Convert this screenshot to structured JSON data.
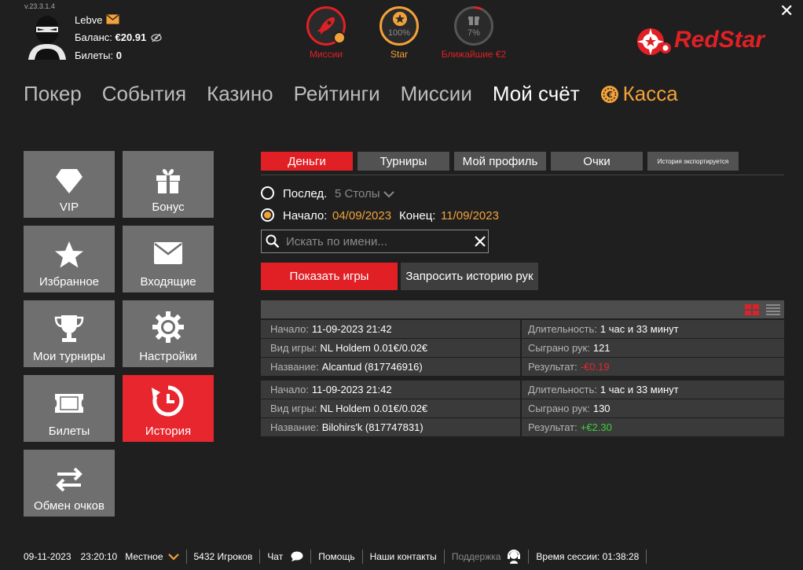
{
  "version": "v.23.3.1.4",
  "user": {
    "name": "Lebve",
    "balance_label": "Баланс:",
    "balance_value": "€20.91",
    "tickets_label": "Билеты:",
    "tickets_value": "0"
  },
  "top_widgets": [
    {
      "label": "Миссии",
      "icon": "rocket-icon",
      "color": "#e12026"
    },
    {
      "label": "Star",
      "value": "100%",
      "icon": "star-icon",
      "color": "#f3a23a"
    },
    {
      "label": "Ближайшие €2",
      "value": "7%",
      "icon": "gift-icon",
      "color": "#e12026"
    }
  ],
  "brand": {
    "logo_text": "RedStar",
    "color": "#e12026"
  },
  "nav": [
    "Покер",
    "События",
    "Казино",
    "Рейтинги",
    "Миссии",
    "Мой счёт",
    "Касса"
  ],
  "tiles": [
    {
      "label": "VIP",
      "icon": "diamond-icon"
    },
    {
      "label": "Бонус",
      "icon": "gift-icon"
    },
    {
      "label": "Избранное",
      "icon": "star-icon"
    },
    {
      "label": "Входящие",
      "icon": "envelope-icon"
    },
    {
      "label": "Мои турниры",
      "icon": "trophy-icon"
    },
    {
      "label": "Настройки",
      "icon": "gear-icon"
    },
    {
      "label": "Билеты",
      "icon": "ticket-icon"
    },
    {
      "label": "История",
      "icon": "history-icon",
      "active": true
    },
    {
      "label": "Обмен очков",
      "icon": "exchange-icon"
    }
  ],
  "tabs": [
    "Деньги",
    "Турниры",
    "Мой профиль",
    "Очки",
    "История экспортируется"
  ],
  "filters": {
    "last_label": "Послед.",
    "last_value": "5 Столы",
    "start_label": "Начало:",
    "start_value": "04/09/2023",
    "end_label": "Конец:",
    "end_value": "11/09/2023"
  },
  "search": {
    "placeholder": "Искать по имени..."
  },
  "buttons": {
    "show_games": "Показать игры",
    "request_history": "Запросить историю рук"
  },
  "games": [
    {
      "start_label": "Начало:",
      "start": "11-09-2023 21:42",
      "duration_label": "Длительность:",
      "duration": "1 час и 33 минут",
      "type_label": "Вид игры:",
      "type": "NL Holdem 0.01€/0.02€",
      "hands_label": "Сыграно рук:",
      "hands": "121",
      "name_label": "Название:",
      "name": "Alcantud (817746916)",
      "result_label": "Результат:",
      "result": "-€0.19"
    },
    {
      "start_label": "Начало:",
      "start": "11-09-2023 21:42",
      "duration_label": "Длительность:",
      "duration": "1 час и 33 минут",
      "type_label": "Вид игры:",
      "type": "NL Holdem 0.01€/0.02€",
      "hands_label": "Сыграно рук:",
      "hands": "130",
      "name_label": "Название:",
      "name": "Bilohirs'k (817747831)",
      "result_label": "Результат:",
      "result": "+€2.30"
    }
  ],
  "footer": {
    "date": "09-11-2023",
    "time": "23:20:10",
    "timezone": "Местное",
    "players": "5432 Игроков",
    "chat": "Чат",
    "help": "Помощь",
    "contacts": "Наши контакты",
    "support": "Поддержка",
    "session_label": "Время сессии:",
    "session_value": "01:38:28"
  }
}
